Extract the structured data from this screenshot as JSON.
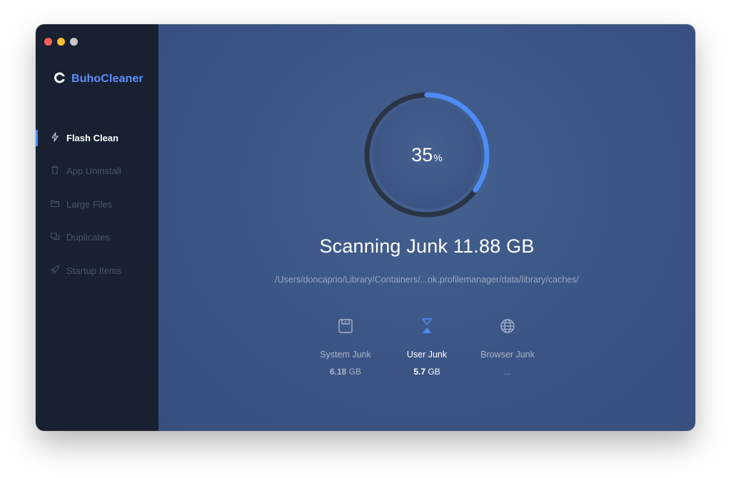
{
  "app": {
    "name": "BuhoCleaner"
  },
  "sidebar": {
    "items": [
      {
        "label": "Flash Clean",
        "icon": "flash-icon",
        "active": true
      },
      {
        "label": "App Uninstall",
        "icon": "trash-icon",
        "active": false
      },
      {
        "label": "Large Files",
        "icon": "folder-icon",
        "active": false
      },
      {
        "label": "Duplicates",
        "icon": "duplicates-icon",
        "active": false
      },
      {
        "label": "Startup Items",
        "icon": "rocket-icon",
        "active": false
      }
    ]
  },
  "scan": {
    "progress_value": "35",
    "progress_unit": "%",
    "progress_fraction": 0.35,
    "headline": "Scanning Junk 11.88 GB",
    "current_path": "/Users/doncaprio/Library/Containers/...ok.profilemanager/data/library/caches/"
  },
  "stats": [
    {
      "label": "System Junk",
      "value": "6.18",
      "unit": "GB",
      "icon": "disk-icon",
      "active": false
    },
    {
      "label": "User Junk",
      "value": "5.7",
      "unit": "GB",
      "icon": "hourglass-icon",
      "active": true
    },
    {
      "label": "Browser Junk",
      "value": "...",
      "unit": "",
      "icon": "globe-icon",
      "active": false
    }
  ],
  "colors": {
    "accent": "#4d8cf5",
    "sidebar_bg": "#182032",
    "main_bg": "#3b5484",
    "ring_track": "#2b3445",
    "brand": "#5b8ff9"
  }
}
